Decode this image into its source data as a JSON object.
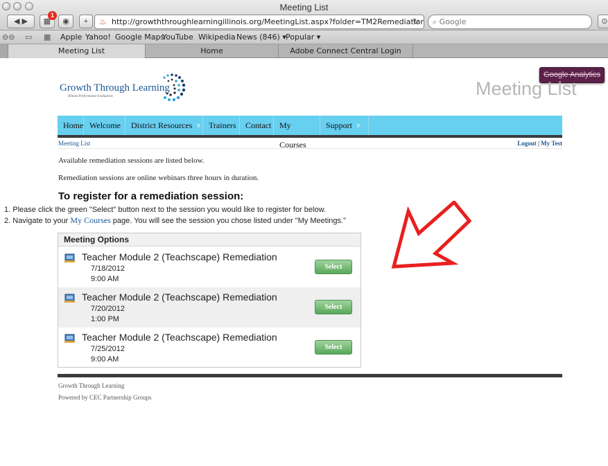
{
  "window": {
    "title": "Meeting List"
  },
  "toolbar": {
    "url": "http://growththroughlearningillinois.org/MeetingList.aspx?folder=TM2Remediation",
    "search_placeholder": "Google",
    "badge": "1"
  },
  "bookmarks": [
    "Apple",
    "Yahoo!",
    "Google Maps",
    "YouTube",
    "Wikipedia",
    "News (846)",
    "Popular"
  ],
  "tabs": [
    "Meeting List",
    "Home",
    "Adobe Connect Central Login"
  ],
  "analytics_button": "Google Analytics",
  "logo": {
    "text": "Growth Through Learning",
    "tagline": "Illinois Performance Evaluation"
  },
  "page_title": "Meeting List",
  "nav": [
    "Home",
    "Welcome",
    "District Resources",
    "Trainers",
    "Contact",
    "My Courses",
    "Support"
  ],
  "breadcrumb": "Meeting List",
  "user_links": {
    "logout": "Logout",
    "separator": "|",
    "user": "My Test"
  },
  "intro": [
    "Available remediation sessions are listed below.",
    "Remediation sessions are online webinars three hours in duration."
  ],
  "register_heading": "To register for a remediation session:",
  "steps": [
    {
      "num": "1.",
      "text": "Please click the green \"Select\" button next to the session you would like to register for below."
    },
    {
      "num": "2.",
      "pre": "Navigate to your ",
      "link": "My Courses",
      "post": " page. You will see the session you chose listed under \"My Meetings.\""
    }
  ],
  "meeting_options": {
    "header": "Meeting Options",
    "sessions": [
      {
        "title": "Teacher Module 2 (Teachscape) Remediation",
        "date": "7/18/2012",
        "time": "9:00 AM",
        "button": "Select"
      },
      {
        "title": "Teacher Module 2 (Teachscape) Remediation",
        "date": "7/20/2012",
        "time": "1:00 PM",
        "button": "Select"
      },
      {
        "title": "Teacher Module 2 (Teachscape) Remediation",
        "date": "7/25/2012",
        "time": "9:00 AM",
        "button": "Select"
      }
    ]
  },
  "footer": {
    "line1": "Growth Through Learning",
    "line2": "Powered by CEC Partnership Groups"
  },
  "colors": {
    "nav": "#67cff0",
    "select_button": "#5aa85a",
    "arrow": "#e8201f",
    "analytics": "#5c2148"
  }
}
